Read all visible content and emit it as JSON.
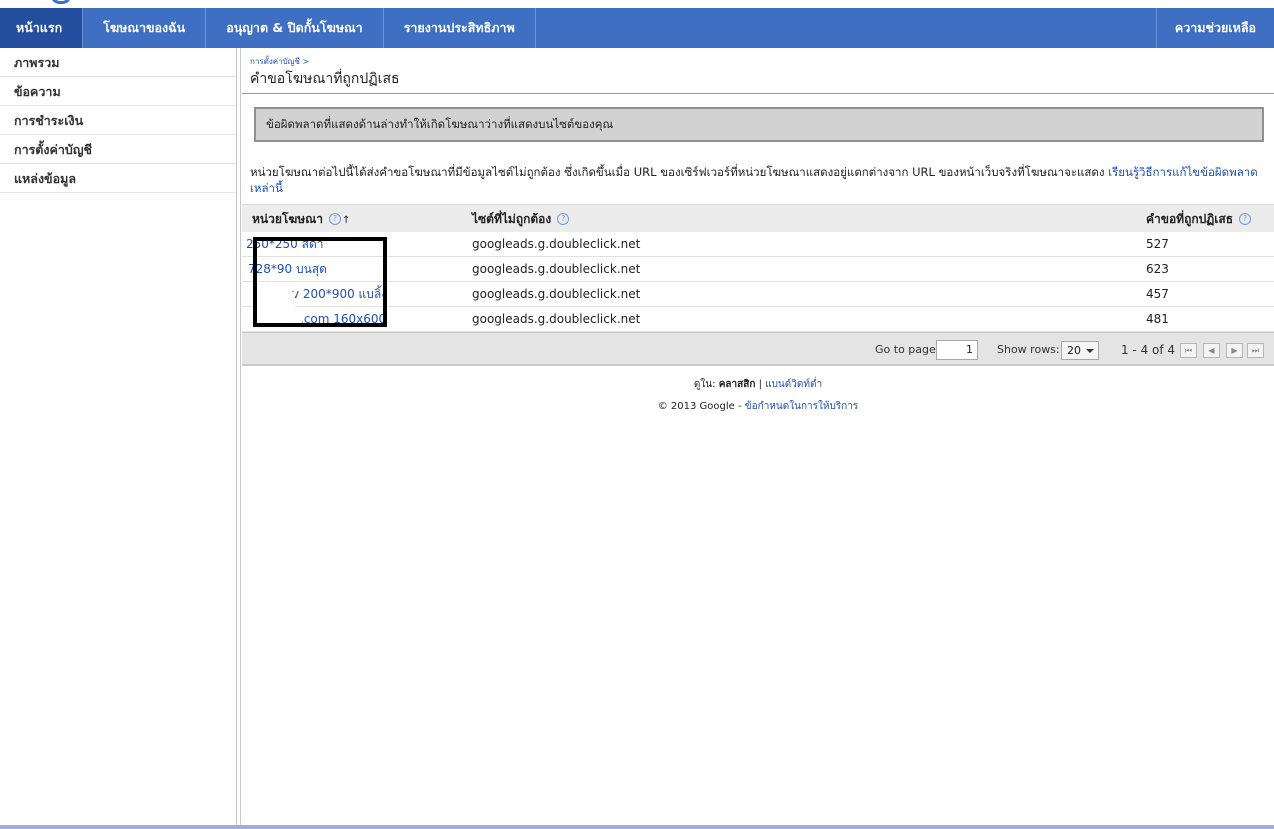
{
  "nav": {
    "tabs": [
      {
        "label": "หน้าแรก",
        "active": true
      },
      {
        "label": "โฆษณาของฉัน"
      },
      {
        "label": "อนุญาต & ปิดกั้นโฆษณา"
      },
      {
        "label": "รายงานประสิทธิภาพ"
      }
    ],
    "help": "ความช่วยเหลือ"
  },
  "sidebar": {
    "items": [
      {
        "label": "ภาพรวม"
      },
      {
        "label": "ข้อความ"
      },
      {
        "label": "การชำระเงิน"
      },
      {
        "label": "การตั้งค่าบัญชี"
      },
      {
        "label": "แหล่งข้อมูล"
      }
    ]
  },
  "main": {
    "breadcrumb": "การตั้งค่าบัญชี >",
    "title": "คำขอโฆษณาที่ถูกปฏิเสธ",
    "error_banner": "ข้อผิดพลาดที่แสดงด้านล่างทำให้เกิดโฆษณาว่างที่แสดงบนไซต์ของคุณ",
    "description": "หน่วยโฆษณาต่อไปนี้ได้ส่งคำขอโฆษณาที่มีข้อมูลไซต์ไม่ถูกต้อง ซึ่งเกิดขึ้นเมื่อ URL ของเซิร์ฟเวอร์ที่หน่วยโฆษณาแสดงอยู่แตกต่างจาก URL ของหน้าเว็บจริงที่โฆษณาจะแสดง",
    "description_link": "เรียนรู้วิธีการแก้ไขข้อผิดพลาดเหล่านี้"
  },
  "table": {
    "headers": {
      "unit": "หน่วยโฆษณา",
      "site": "ไซต์ที่ไม่ถูกต้อง",
      "count": "คำขอที่ถูกปฏิเสธ"
    },
    "sort_icon": "↑",
    "help_icon": "?",
    "rows": [
      {
        "unit": "250*250 สด้า",
        "site": "googleads.g.doubleclick.net",
        "count": "527"
      },
      {
        "unit": "728*90 บนสุด",
        "site": "googleads.g.doubleclick.net",
        "count": "623"
      },
      {
        "unit": "v 200*900 แบลิ้ง",
        "site": "googleads.g.doubleclick.net",
        "count": "457"
      },
      {
        "unit": ".com 160x600",
        "site": "googleads.g.doubleclick.net",
        "count": "481"
      }
    ]
  },
  "pager": {
    "go_to_label": "Go to page:",
    "page_value": "1",
    "show_rows_label": "Show rows:",
    "rows_value": "20",
    "range": "1 - 4 of 4",
    "buttons": {
      "first": "⏮",
      "prev": "◀",
      "next": "▶",
      "last": "⏭"
    }
  },
  "footer": {
    "view_prefix": "ดูใน:",
    "view_classic": "คลาสสิก",
    "separator": "|",
    "view_low_bw": "แบนด์วิดท์ต่ำ",
    "copyright": "© 2013 Google -",
    "terms": "ข้อกำหนดในการให้บริการ"
  }
}
